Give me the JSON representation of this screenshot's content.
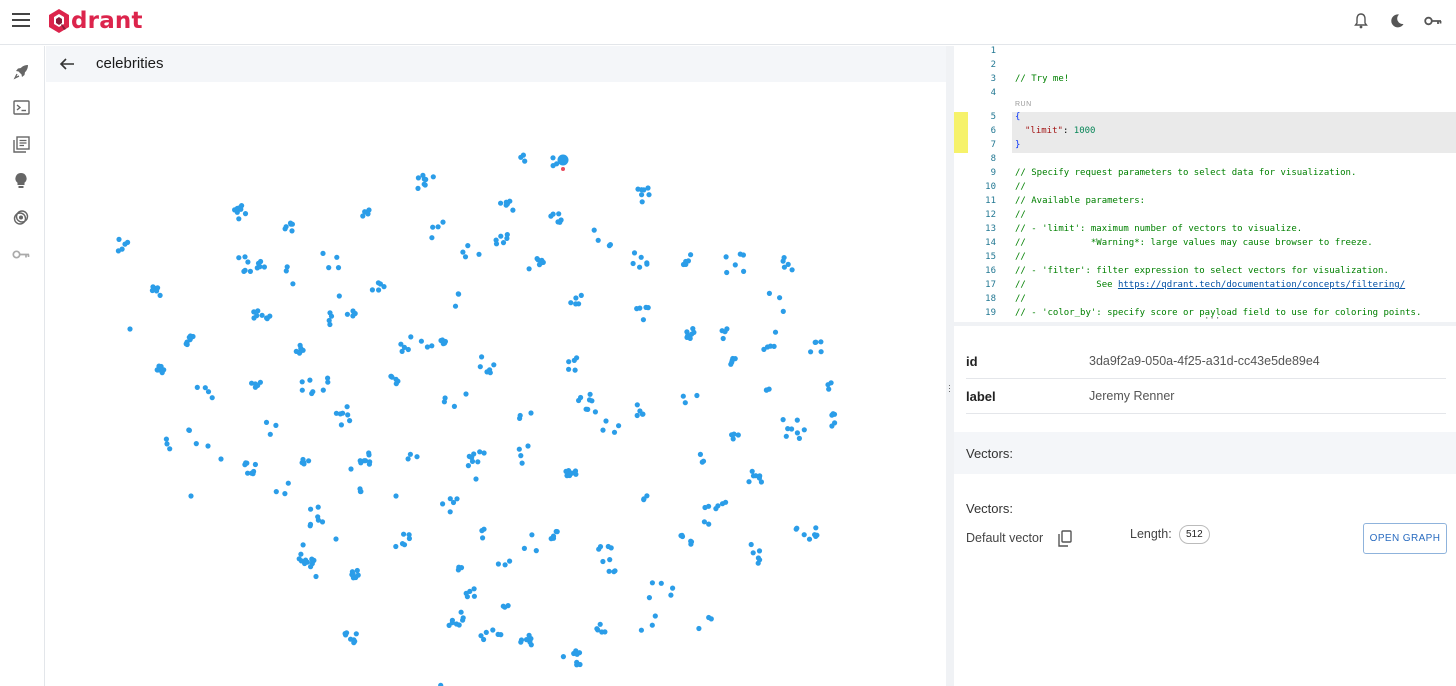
{
  "app": {
    "logo_text": "drant",
    "brand_color": "#dc244c"
  },
  "topbar": {
    "icons": [
      "menu-icon",
      "bell-icon",
      "moon-icon",
      "key-icon"
    ]
  },
  "sidebar": {
    "icons": [
      "rocket-icon",
      "terminal-icon",
      "collections-icon",
      "lightbulb-icon",
      "datasets-icon",
      "access-key-icon"
    ]
  },
  "header": {
    "title": "celebrities"
  },
  "editor": {
    "run_label": "RUN",
    "lines": [
      {
        "n": "1",
        "text": "",
        "kind": "comment"
      },
      {
        "n": "2",
        "text": "",
        "kind": "comment"
      },
      {
        "n": "3",
        "text": "// Try me!",
        "kind": "comment"
      },
      {
        "n": "4",
        "text": "",
        "kind": "comment"
      },
      {
        "n": "5",
        "text": "{",
        "kind": "brace"
      },
      {
        "n": "6",
        "text": "",
        "kind": "json",
        "key": "\"limit\"",
        "sep": ": ",
        "value": "1000"
      },
      {
        "n": "7",
        "text": "}",
        "kind": "brace"
      },
      {
        "n": "8",
        "text": "",
        "kind": "comment"
      },
      {
        "n": "9",
        "text": "// Specify request parameters to select data for visualization.",
        "kind": "comment"
      },
      {
        "n": "10",
        "text": "//",
        "kind": "comment"
      },
      {
        "n": "11",
        "text": "// Available parameters:",
        "kind": "comment"
      },
      {
        "n": "12",
        "text": "//",
        "kind": "comment"
      },
      {
        "n": "13",
        "text": "// - 'limit': maximum number of vectors to visualize.",
        "kind": "comment"
      },
      {
        "n": "14",
        "text": "//            *Warning*: large values may cause browser to freeze.",
        "kind": "comment"
      },
      {
        "n": "15",
        "text": "//",
        "kind": "comment"
      },
      {
        "n": "16",
        "text": "// - 'filter': filter expression to select vectors for visualization.",
        "kind": "comment"
      },
      {
        "n": "17",
        "text": "//             See ",
        "kind": "comment",
        "link": "https://qdrant.tech/documentation/concepts/filtering/"
      },
      {
        "n": "18",
        "text": "//",
        "kind": "comment"
      },
      {
        "n": "19",
        "text": "// - 'color_by': specify score or payload field to use for coloring points.",
        "kind": "comment"
      }
    ]
  },
  "point_details": {
    "id_key": "id",
    "id_value": "3da9f2a9-050a-4f25-a31d-cc43e5de89e4",
    "label_key": "label",
    "label_value": "Jeremy Renner",
    "vectors_band": "Vectors:",
    "vectors_title": "Vectors:",
    "default_vector_label": "Default vector",
    "length_label": "Length:",
    "length_value": "512",
    "open_graph_label": "OPEN GRAPH"
  },
  "plot": {
    "point_color": "#2b9de8",
    "highlight_color": "#e94b5b"
  }
}
